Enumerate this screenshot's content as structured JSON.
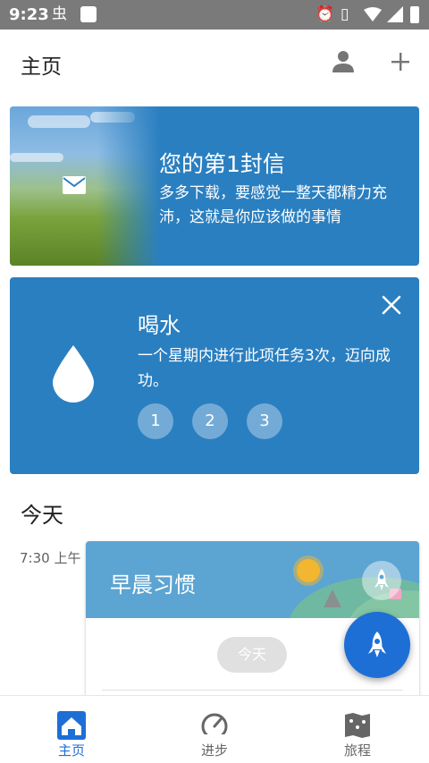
{
  "status_bar": {
    "time": "9:23",
    "app_glyph": "虫"
  },
  "app_bar": {
    "title": "主页"
  },
  "letter_card": {
    "title": "您的第1封信",
    "body": "多多下载，要感觉一整天都精力充沛，这就是你应该做的事情"
  },
  "water_card": {
    "title": "喝水",
    "body": "一个星期内进行此项任务3次，迈向成功。",
    "steps": [
      "1",
      "2",
      "3"
    ]
  },
  "today": {
    "heading": "今天",
    "habit_time": "7:30 上午",
    "habit_title": "早晨习惯",
    "pill_label": "今天"
  },
  "bottom_nav": {
    "items": [
      {
        "label": "主页",
        "icon": "home-icon",
        "active": true
      },
      {
        "label": "进步",
        "icon": "gauge-icon",
        "active": false
      },
      {
        "label": "旅程",
        "icon": "map-icon",
        "active": false
      }
    ]
  },
  "colors": {
    "card_blue": "#2a7fc0",
    "accent_blue": "#1d6fd6",
    "status_gray": "#7a7a7a"
  }
}
